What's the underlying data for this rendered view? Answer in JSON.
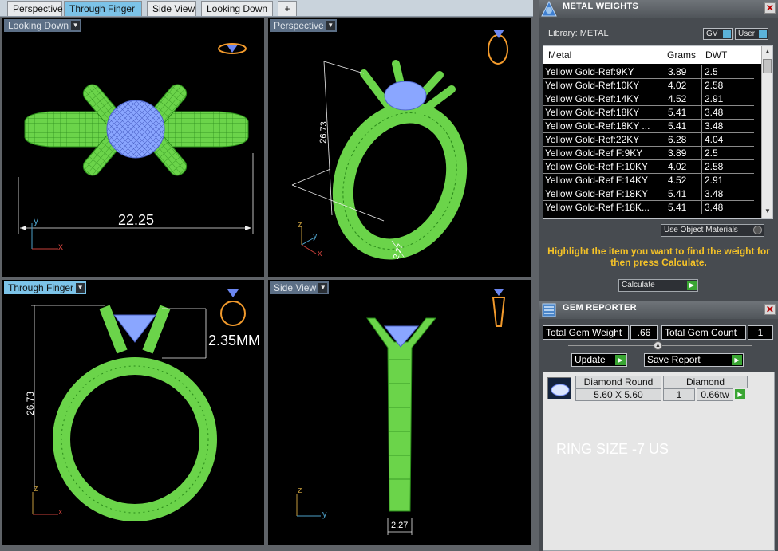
{
  "tabs": [
    {
      "label": "Perspective"
    },
    {
      "label": "Through Finger"
    },
    {
      "label": "Side View"
    },
    {
      "label": "Looking Down"
    },
    {
      "label": "+"
    }
  ],
  "viewports": {
    "looking_down": {
      "label": "Looking Down",
      "dimension": "22.25",
      "axis_y": "y",
      "axis_x": "x"
    },
    "perspective": {
      "label": "Perspective",
      "dimension_height": "26.73",
      "dimension_small": "2.27",
      "axis_z": "z",
      "axis_y": "y",
      "axis_x": "x"
    },
    "through_finger": {
      "label": "Through Finger",
      "dimension_height": "26.73",
      "dimension_mm": "2.35MM",
      "axis_z": "z",
      "axis_x": "x"
    },
    "side_view": {
      "label": "Side View",
      "dimension_small": "2.27",
      "axis_z": "z",
      "axis_y": "y"
    }
  },
  "metal_weights": {
    "title": "METAL WEIGHTS",
    "library": "Library: METAL",
    "toggle_gv": "GV",
    "toggle_user": "User",
    "columns": [
      "Metal",
      "Grams",
      "DWT"
    ],
    "rows": [
      {
        "metal": "Yellow Gold-Ref:9KY",
        "grams": "3.89",
        "dwt": "2.5"
      },
      {
        "metal": "Yellow Gold-Ref:10KY",
        "grams": "4.02",
        "dwt": "2.58"
      },
      {
        "metal": "Yellow Gold-Ref:14KY",
        "grams": "4.52",
        "dwt": "2.91"
      },
      {
        "metal": "Yellow Gold-Ref:18KY",
        "grams": "5.41",
        "dwt": "3.48"
      },
      {
        "metal": "Yellow Gold-Ref:18KY ...",
        "grams": "5.41",
        "dwt": "3.48"
      },
      {
        "metal": "Yellow Gold-Ref:22KY",
        "grams": "6.28",
        "dwt": "4.04"
      },
      {
        "metal": "Yellow Gold-Ref F:9KY",
        "grams": "3.89",
        "dwt": "2.5"
      },
      {
        "metal": "Yellow Gold-Ref F:10KY",
        "grams": "4.02",
        "dwt": "2.58"
      },
      {
        "metal": "Yellow Gold-Ref F:14KY",
        "grams": "4.52",
        "dwt": "2.91"
      },
      {
        "metal": "Yellow Gold-Ref F:18KY",
        "grams": "5.41",
        "dwt": "3.48"
      },
      {
        "metal": "Yellow Gold-Ref F:18K...",
        "grams": "5.41",
        "dwt": "3.48"
      }
    ],
    "use_object_materials": "Use Object Materials",
    "hint": "Highlight the item you want to find the weight for then press Calculate.",
    "calculate": "Calculate"
  },
  "gem_reporter": {
    "title": "GEM REPORTER",
    "total_weight_label": "Total Gem Weight",
    "total_weight_value": ".66",
    "total_count_label": "Total Gem Count",
    "total_count_value": "1",
    "update": "Update",
    "save_report": "Save Report",
    "gems": [
      {
        "name": "Diamond Round",
        "size": "5.60 X 5.60",
        "material": "Diamond",
        "count": "1",
        "weight": "0.66tw"
      }
    ],
    "ring_size_note": "RING SIZE -7 US"
  },
  "colors": {
    "ring_wire": "#7cff50",
    "gem": "#7f9cf5",
    "active_tab": "#7cc3e8",
    "hint_text": "#f3c128",
    "go_button": "#3aa533"
  }
}
